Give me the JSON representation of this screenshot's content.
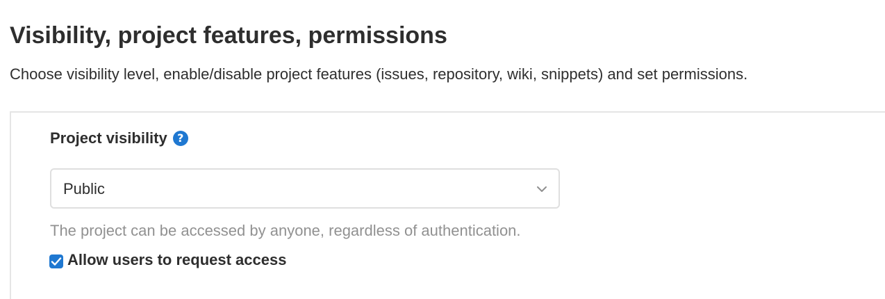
{
  "section": {
    "title": "Visibility, project features, permissions",
    "description": "Choose visibility level, enable/disable project features (issues, repository, wiki, snippets) and set permissions."
  },
  "project_visibility": {
    "label": "Project visibility",
    "help_icon": "question-circle-icon",
    "help_glyph": "?",
    "selected_value": "Public",
    "dropdown_icon": "chevron-down-icon",
    "help_text": "The project can be accessed by anyone, regardless of authentication."
  },
  "request_access": {
    "label": "Allow users to request access",
    "checked": true
  },
  "colors": {
    "accent": "#1f78d1",
    "text": "#2e2e2e",
    "muted_text": "#919191",
    "border": "#dfdfdf"
  }
}
